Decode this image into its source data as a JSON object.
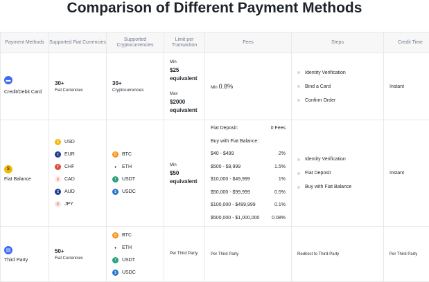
{
  "title": "Comparison of Different Payment Methods",
  "headers": [
    "Payment Methods",
    "Supported Fiat Currencies",
    "Supported Cryptocurrencies",
    "Limit per Transaction",
    "Fees",
    "Steps",
    "Credit Time"
  ],
  "rows": [
    {
      "method": "Credit/Debit Card",
      "fiat_count": "30+",
      "fiat_label": "Fiat Currencies",
      "crypto_count": "30+",
      "crypto_label": "Cryptocurrencies",
      "limit_min_label": "Min",
      "limit_min": "$25 equivalent",
      "limit_max_label": "Max",
      "limit_max": "$2000 equivalent",
      "fee_prefix": "Min",
      "fee": "0.8%",
      "steps": [
        "Identity Verification",
        "Bind a Card",
        "Confirm Order"
      ],
      "credit_time": "Instant"
    },
    {
      "method": "Fiat Balance",
      "fiat": [
        "USD",
        "EUR",
        "CHF",
        "CAD",
        "AUD",
        "JPY"
      ],
      "crypto": [
        "BTC",
        "ETH",
        "USDT",
        "USDC"
      ],
      "limit_min_label": "Min",
      "limit_min": "$50 equivalent",
      "fees": [
        [
          "Fiat Deposit:",
          "0 Fees"
        ],
        [
          "Buy with Fiat Balance:",
          ""
        ],
        [
          "$40 - $499",
          "2%"
        ],
        [
          "$500 - $9,999",
          "1.5%"
        ],
        [
          "$10,000 - $49,999",
          "1%"
        ],
        [
          "$50,000 - $99,999",
          "0.5%"
        ],
        [
          "$100,000 - $499,999",
          "0.1%"
        ],
        [
          "$500,000 - $1,000,000",
          "0.08%"
        ]
      ],
      "steps": [
        "Identity Verification",
        "Fiat Deposit",
        "Buy with Fiat Balance"
      ],
      "credit_time": "Instant"
    },
    {
      "method": "Third Party",
      "fiat_count": "50+",
      "fiat_label": "Fiat Currencies",
      "crypto": [
        "BTC",
        "ETH",
        "USDT",
        "USDC"
      ],
      "limit": "Per Third Party",
      "fee": "Per Third Party",
      "step": "Redirect to Third-Party",
      "credit_time": "Per Third Party"
    }
  ],
  "colors": {
    "USD": "#f0b90b",
    "EUR": "#1d3b8f",
    "CHF": "#e0483b",
    "CAD": "#e0483b",
    "AUD": "#1d3b8f",
    "JPY": "#c0392b",
    "BTC": "#f7931a",
    "ETH": "#333",
    "USDT": "#26a17b",
    "USDC": "#2775ca"
  }
}
